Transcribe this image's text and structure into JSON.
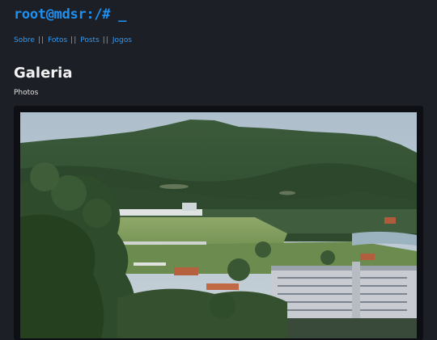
{
  "site": {
    "title": "root@mdsr:/# _"
  },
  "nav": {
    "items": [
      {
        "label": "Sobre"
      },
      {
        "label": "Fotos"
      },
      {
        "label": "Posts"
      },
      {
        "label": "Jogos"
      }
    ],
    "separator": "||"
  },
  "page": {
    "title": "Galeria",
    "subtitle": "Photos"
  },
  "colors": {
    "background": "#1d1f27",
    "link": "#2f9bf5",
    "heading": "#f2f2f2"
  }
}
